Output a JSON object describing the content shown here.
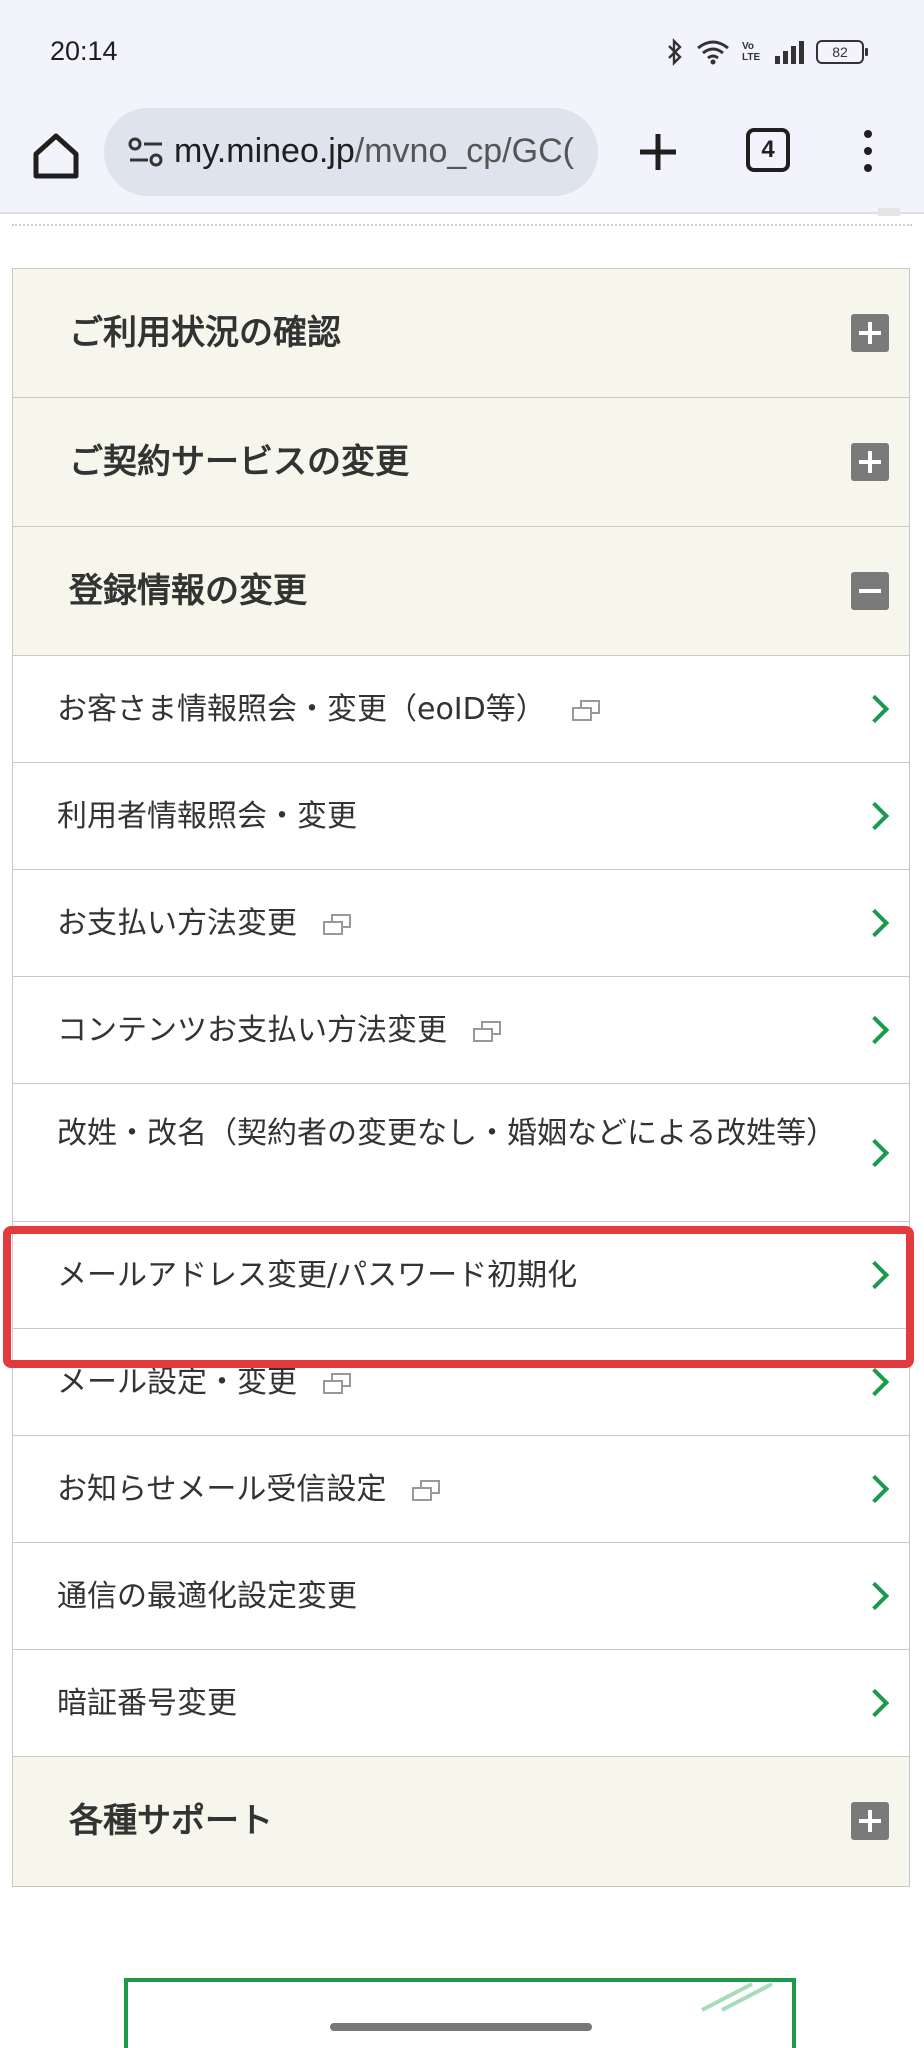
{
  "status_bar": {
    "time": "20:14",
    "battery": "82",
    "network_label": "Vo LTE"
  },
  "browser": {
    "url_host": "my.mineo.jp",
    "url_path": "/mvno_cp/GC(",
    "tab_count": "4"
  },
  "menu": {
    "sections": [
      {
        "title": "ご利用状況の確認",
        "state": "collapsed"
      },
      {
        "title": "ご契約サービスの変更",
        "state": "collapsed"
      },
      {
        "title": "登録情報の変更",
        "state": "expanded"
      },
      {
        "title": "各種サポート",
        "state": "collapsed"
      }
    ],
    "items": [
      {
        "label": "お客さま情報照会・変更（eoID等）",
        "external": true
      },
      {
        "label": "利用者情報照会・変更",
        "external": false
      },
      {
        "label": "お支払い方法変更",
        "external": true
      },
      {
        "label": "コンテンツお支払い方法変更",
        "external": true
      },
      {
        "label": "改姓・改名（契約者の変更なし・婚姻などによる改姓等）",
        "external": false
      },
      {
        "label": "メールアドレス変更/パスワード初期化",
        "external": false,
        "highlighted": true
      },
      {
        "label": "メール設定・変更",
        "external": true
      },
      {
        "label": "お知らせメール受信設定",
        "external": true
      },
      {
        "label": "通信の最適化設定変更",
        "external": false
      },
      {
        "label": "暗証番号変更",
        "external": false
      }
    ]
  },
  "colors": {
    "section_bg": "#f6f6ec",
    "chevron": "#1a9a4a",
    "highlight": "#e23b3e",
    "toggle_bg": "#7a7a7a"
  }
}
